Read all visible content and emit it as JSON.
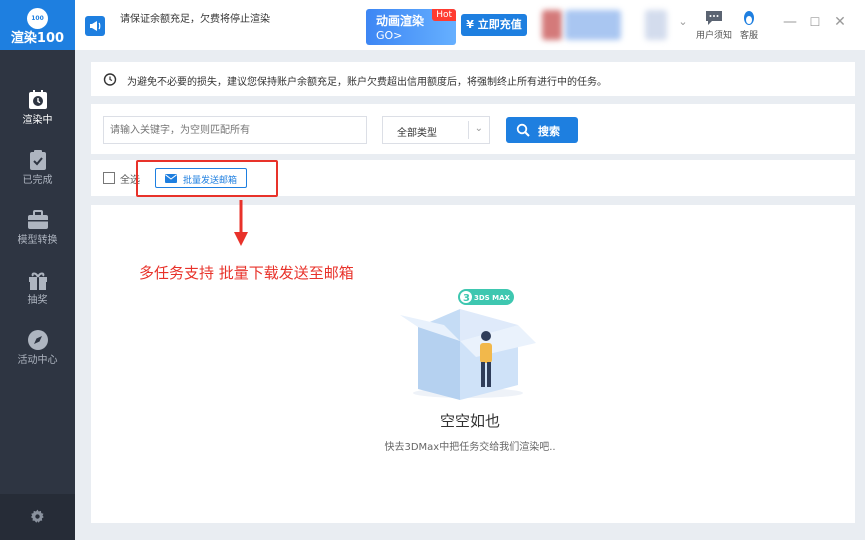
{
  "app": {
    "logo_badge": "100",
    "logo_text": "渲染100"
  },
  "header": {
    "notice": "请保证余额充足，欠费将停止渲染",
    "anim_title": "动画渲染",
    "anim_go": "GO>",
    "hot": "Hot",
    "recharge": "¥ 立即充值",
    "user_notice": "用户须知",
    "service": "客服"
  },
  "sidebar": {
    "items": [
      {
        "label": "渲染中",
        "icon": "clock-icon"
      },
      {
        "label": "已完成",
        "icon": "clipboard-check-icon"
      },
      {
        "label": "模型转换",
        "icon": "briefcase-icon"
      },
      {
        "label": "抽奖",
        "icon": "gift-icon"
      },
      {
        "label": "活动中心",
        "icon": "compass-icon"
      }
    ],
    "settings_icon": "gear-icon"
  },
  "tip": {
    "text": "为避免不必要的损失，建议您保持账户余额充足，账户欠费超出信用额度后，将强制终止所有进行中的任务。"
  },
  "search": {
    "placeholder": "请输入关键字，为空则匹配所有",
    "type_value": "全部类型",
    "button": "搜索"
  },
  "select": {
    "select_all": "全选",
    "batch_email": "批量发送邮箱"
  },
  "annotation": "多任务支持 批量下载发送至邮箱",
  "empty": {
    "badge": "3DS MAX",
    "title": "空空如也",
    "subtitle": "快去3DMax中把任务交给我们渲染吧.."
  },
  "colors": {
    "brand": "#1e7fe0",
    "sidebar": "#2e3542",
    "annotation": "#e8322a"
  }
}
